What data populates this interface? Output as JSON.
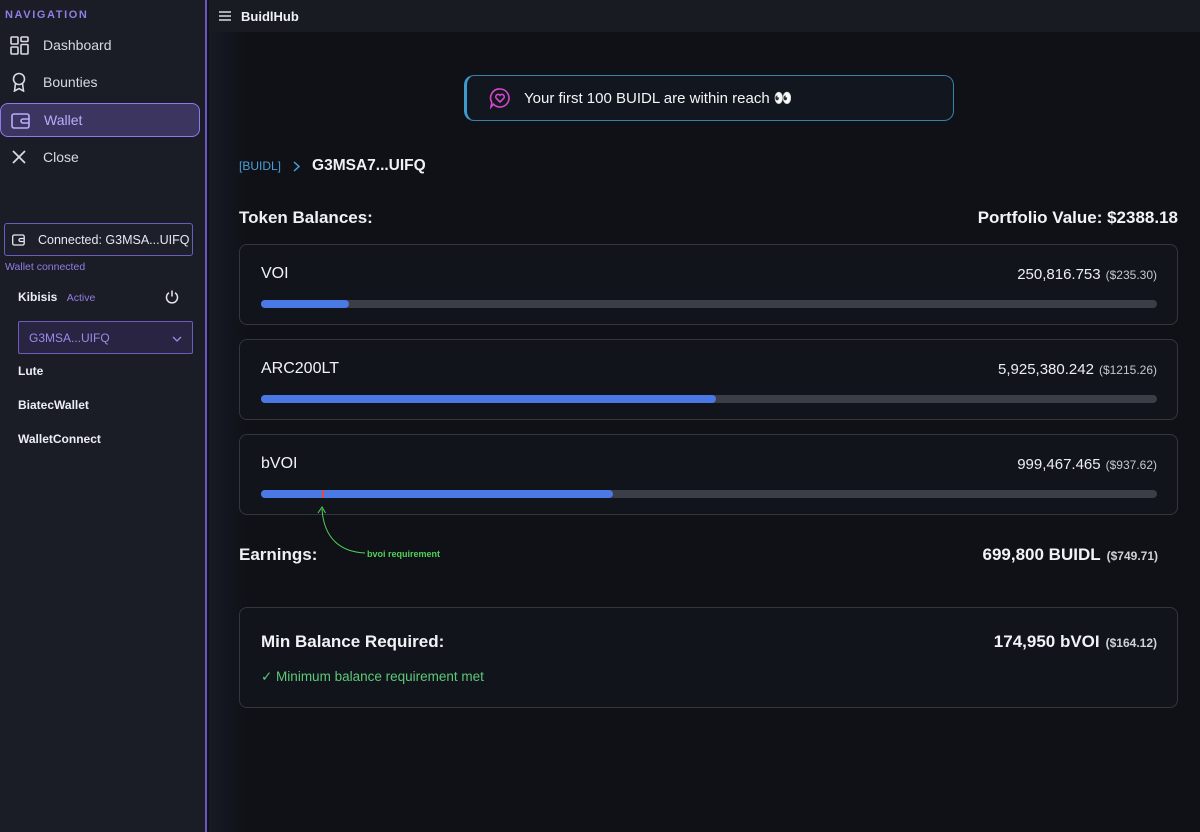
{
  "sidebar": {
    "heading": "NAVIGATION",
    "items": [
      {
        "label": "Dashboard",
        "icon": "dashboard-icon"
      },
      {
        "label": "Bounties",
        "icon": "award-icon"
      },
      {
        "label": "Wallet",
        "icon": "wallet-icon",
        "active": true
      },
      {
        "label": "Close",
        "icon": "close-icon"
      }
    ],
    "connection_label": "Connected: G3MSA...UIFQ",
    "wallet_status": "Wallet connected",
    "providers": [
      {
        "name": "Kibisis",
        "status": "Active"
      },
      {
        "name": "Lute"
      },
      {
        "name": "BiatecWallet"
      },
      {
        "name": "WalletConnect"
      }
    ],
    "account_selected": "G3MSA...UIFQ"
  },
  "topbar": {
    "title": "BuidlHub"
  },
  "banner": {
    "text": "Your first 100 BUIDL are within reach 👀"
  },
  "breadcrumb": {
    "parent": "[BUIDL]",
    "current": "G3MSA7...UIFQ"
  },
  "balances": {
    "title": "Token Balances:",
    "portfolio": "Portfolio Value: $2388.18",
    "tokens": [
      {
        "name": "VOI",
        "amount": "250,816.753",
        "usd": "($235.30)",
        "progress": 0.098
      },
      {
        "name": "ARC200LT",
        "amount": "5,925,380.242",
        "usd": "($1215.26)",
        "progress": 0.508
      },
      {
        "name": "bVOI",
        "amount": "999,467.465",
        "usd": "($937.62)",
        "progress": 0.393,
        "requirement": 0.068
      }
    ]
  },
  "annotation": {
    "text": "bvoi requirement"
  },
  "earnings": {
    "title": "Earnings:",
    "value": "699,800 BUIDL",
    "usd": "($749.71)"
  },
  "min_balance": {
    "title": "Min Balance Required:",
    "value": "174,950 bVOI",
    "usd": "($164.12)",
    "status": "✓ Minimum balance requirement met"
  },
  "colors": {
    "accent": "#8f7ee6",
    "bar": "#4a78e4",
    "success": "#5cc878",
    "link": "#4a9fd8"
  }
}
